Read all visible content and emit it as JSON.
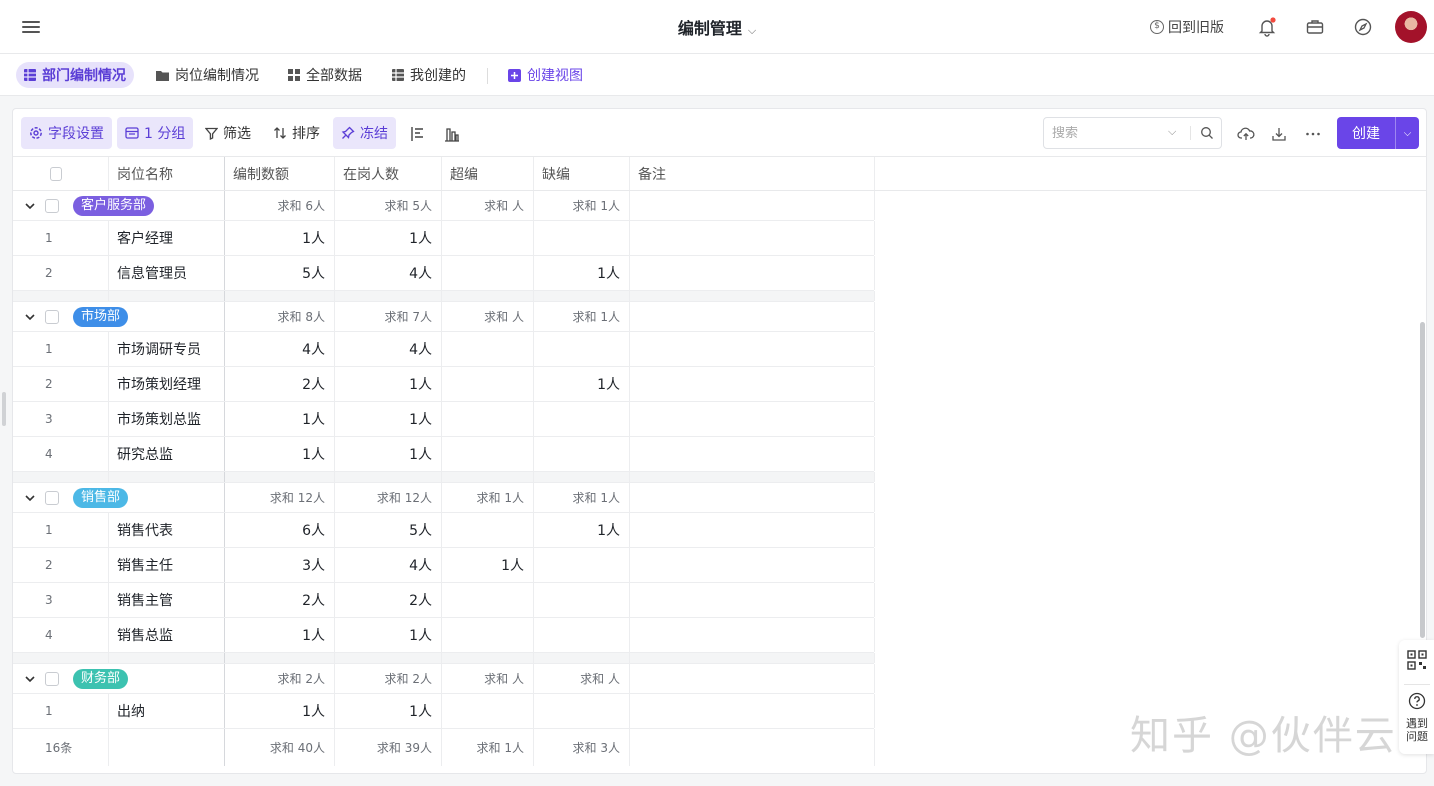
{
  "header": {
    "title": "编制管理",
    "old_version": "回到旧版"
  },
  "views": [
    {
      "label": "部门编制情况",
      "icon": "grid-table-icon"
    },
    {
      "label": "岗位编制情况",
      "icon": "folder-icon"
    },
    {
      "label": "全部数据",
      "icon": "four-squares-icon"
    },
    {
      "label": "我创建的",
      "icon": "table-icon"
    },
    {
      "label": "创建视图",
      "icon": "plus-square-icon"
    }
  ],
  "toolbar": {
    "field_settings": "字段设置",
    "group": "1 分组",
    "filter": "筛选",
    "sort": "排序",
    "freeze": "冻结",
    "search_placeholder": "搜索",
    "create": "创建"
  },
  "columns": [
    "岗位名称",
    "编制数额",
    "在岗人数",
    "超编",
    "缺编",
    "备注"
  ],
  "groups": [
    {
      "name": "客户服务部",
      "color": "#7b5fe0",
      "sum": [
        "求和 6人",
        "求和 5人",
        "求和 人",
        "求和 1人"
      ],
      "rows": [
        {
          "idx": "1",
          "name": "客户经理",
          "quota": "1人",
          "onjob": "1人",
          "over": "",
          "short": ""
        },
        {
          "idx": "2",
          "name": "信息管理员",
          "quota": "5人",
          "onjob": "4人",
          "over": "",
          "short": "1人"
        }
      ]
    },
    {
      "name": "市场部",
      "color": "#3e8ee8",
      "sum": [
        "求和 8人",
        "求和 7人",
        "求和 人",
        "求和 1人"
      ],
      "rows": [
        {
          "idx": "1",
          "name": "市场调研专员",
          "quota": "4人",
          "onjob": "4人",
          "over": "",
          "short": ""
        },
        {
          "idx": "2",
          "name": "市场策划经理",
          "quota": "2人",
          "onjob": "1人",
          "over": "",
          "short": "1人"
        },
        {
          "idx": "3",
          "name": "市场策划总监",
          "quota": "1人",
          "onjob": "1人",
          "over": "",
          "short": ""
        },
        {
          "idx": "4",
          "name": "研究总监",
          "quota": "1人",
          "onjob": "1人",
          "over": "",
          "short": ""
        }
      ]
    },
    {
      "name": "销售部",
      "color": "#4cb8e6",
      "sum": [
        "求和 12人",
        "求和 12人",
        "求和 1人",
        "求和 1人"
      ],
      "rows": [
        {
          "idx": "1",
          "name": "销售代表",
          "quota": "6人",
          "onjob": "5人",
          "over": "",
          "short": "1人"
        },
        {
          "idx": "2",
          "name": "销售主任",
          "quota": "3人",
          "onjob": "4人",
          "over": "1人",
          "short": ""
        },
        {
          "idx": "3",
          "name": "销售主管",
          "quota": "2人",
          "onjob": "2人",
          "over": "",
          "short": ""
        },
        {
          "idx": "4",
          "name": "销售总监",
          "quota": "1人",
          "onjob": "1人",
          "over": "",
          "short": ""
        }
      ]
    },
    {
      "name": "财务部",
      "color": "#3cc2b0",
      "sum": [
        "求和 2人",
        "求和 2人",
        "求和 人",
        "求和 人"
      ],
      "rows": [
        {
          "idx": "1",
          "name": "出纳",
          "quota": "1人",
          "onjob": "1人",
          "over": "",
          "short": ""
        }
      ]
    }
  ],
  "footer": {
    "count": "16条",
    "sum": [
      "求和 40人",
      "求和 39人",
      "求和 1人",
      "求和 3人"
    ]
  },
  "side_panel": {
    "help": "遇到问题"
  },
  "watermark": "知乎 @伙伴云"
}
